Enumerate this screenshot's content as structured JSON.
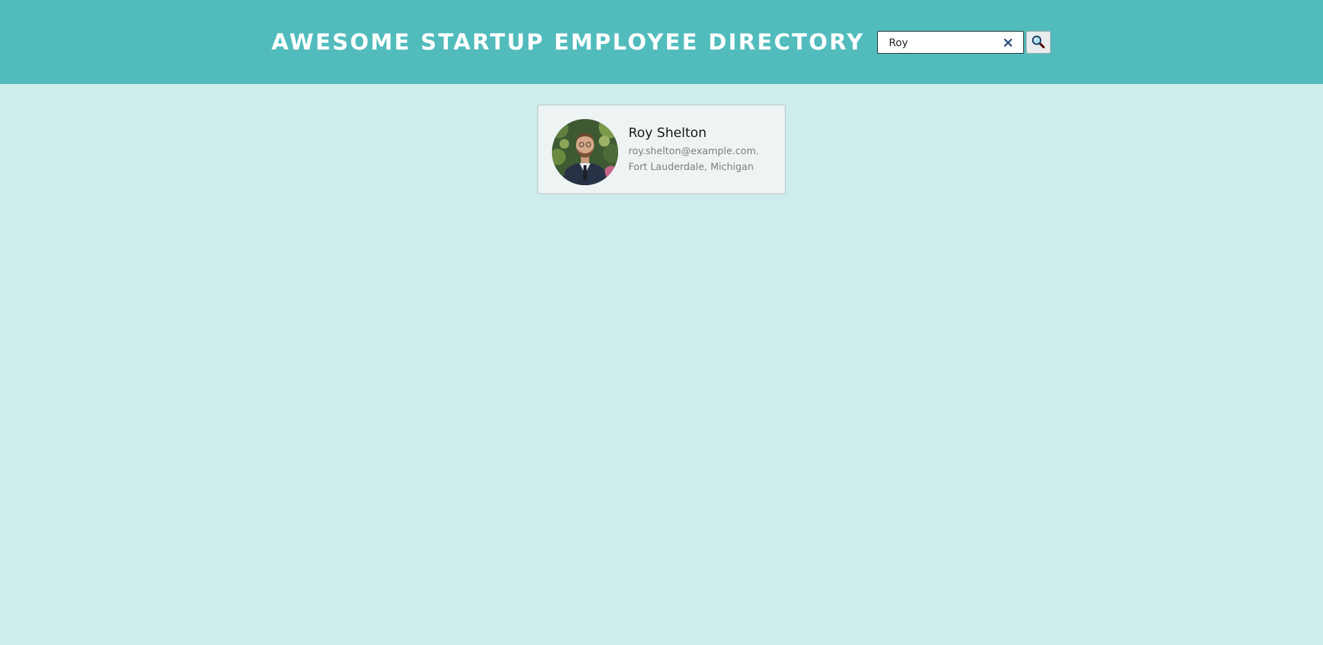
{
  "header": {
    "title": "AWESOME STARTUP EMPLOYEE DIRECTORY"
  },
  "search": {
    "value": "Roy",
    "clear_icon": "close-icon",
    "submit_icon": "search-icon"
  },
  "employees": [
    {
      "name": "Roy Shelton",
      "email": "roy.shelton@example.com...",
      "location": "Fort Lauderdale, Michigan",
      "avatar_icon": "employee-photo"
    }
  ],
  "colors": {
    "header_bg": "#52bcbd",
    "page_bg": "#cdeceb",
    "card_bg": "#eef3f3",
    "title_text": "#ffffff",
    "clear_icon": "#2f4f7a"
  }
}
